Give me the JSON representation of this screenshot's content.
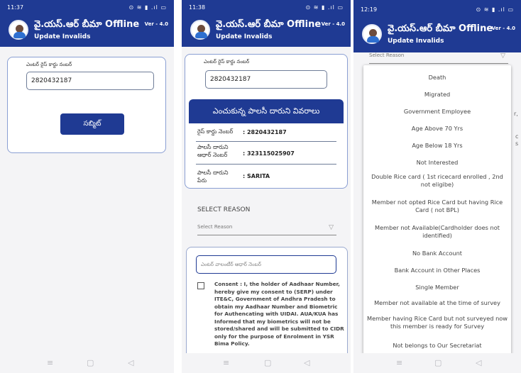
{
  "header": {
    "title": "వై.యస్.ఆర్ బీమా Offline",
    "subtitle": "Update Invalids",
    "version": "Ver - 4.0"
  },
  "status_bar": {
    "icons": "⊙ ≋ ▮ .ıl ▭"
  },
  "navbar": {
    "menu": "≡",
    "home": "▢",
    "back": "◁"
  },
  "screen1": {
    "time": "11:37",
    "rice_card_label": "ఎంటర్ రైస్ కార్డు నంబర్",
    "rice_card_value": "2820432187",
    "submit_label": "సబ్మిట్"
  },
  "screen2": {
    "time": "11:38",
    "rice_card_label": "ఎంటర్ రైస్ కార్డు నంబర్",
    "rice_card_value": "2820432187",
    "details_title": "ఎంచుకున్న పాలసీ దారుని వివరాలు",
    "rows": [
      {
        "label": "రైస్ కార్డు నెంబర్",
        "value": ": 2820432187"
      },
      {
        "label": "పాలసీ దారుని ఆధార్ నెంబర్",
        "value": ": 323115025907"
      },
      {
        "label": "పాలసీ దారుని పేరు",
        "value": ": SARITA"
      }
    ],
    "select_reason_heading": "SELECT REASON",
    "select_reason_placeholder": "Select Reason",
    "volunteer_aadhaar_placeholder": "ఎంటర్ వాలంటీర్ ఆధార్ నెంబర్",
    "consent_text": "Consent : I, the holder of Aadhaar Number, hereby give my consent to (SERP) under ITE&C, Government of Andhra Pradesh to obtain my Aadhaar Number and Biometric for Authencating with UIDAI. AUA/KUA has Informed that my biometrics will not be stored/shared and will be submitted to CIDR only for the purpose of Enrolment in YSR Bima Policy."
  },
  "screen3": {
    "time": "12:19",
    "select_reason_placeholder": "Select Reason",
    "background_glimpses": [
      "r,",
      "c",
      "s"
    ],
    "reasons": [
      "Death",
      "Migrated",
      "Government Employee",
      "Age Above 70 Yrs",
      "Age Below 18 Yrs",
      "Not Interested",
      "Double Rice card ( 1st ricecard enrolled , 2nd not eligibe)",
      "Member not opted Rice Card but having Rice Card ( not BPL)",
      "Member not Available(Cardholder does not identified)",
      "No Bank Account",
      "Bank Account in Other Places",
      "Single Member",
      "Member not available at the time of survey",
      "Member having Rice Card but not surveyed now this member is ready for Survey",
      "Not belongs to Our Secretariat"
    ]
  }
}
